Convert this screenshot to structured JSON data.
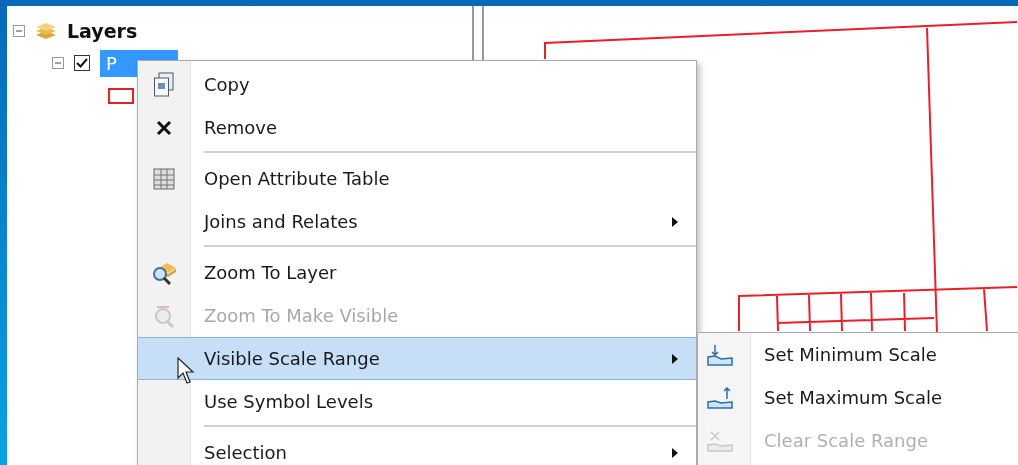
{
  "toc": {
    "root": {
      "label": "Layers",
      "expanded": true,
      "children": [
        {
          "label": "P",
          "checked": true,
          "selected": true,
          "expanded": true
        }
      ]
    }
  },
  "context_menu": {
    "items": [
      {
        "kind": "item",
        "label": "Copy",
        "disabled": false,
        "selected": false,
        "has_submenu": false
      },
      {
        "kind": "item",
        "label": "Remove",
        "disabled": false,
        "selected": false,
        "has_submenu": false
      },
      {
        "kind": "separator"
      },
      {
        "kind": "item",
        "label": "Open Attribute Table",
        "disabled": false,
        "selected": false,
        "has_submenu": false
      },
      {
        "kind": "item",
        "label": "Joins and Relates",
        "disabled": false,
        "selected": false,
        "has_submenu": true
      },
      {
        "kind": "separator"
      },
      {
        "kind": "item",
        "label": "Zoom To Layer",
        "disabled": false,
        "selected": false,
        "has_submenu": false
      },
      {
        "kind": "item",
        "label": "Zoom To Make Visible",
        "disabled": true,
        "selected": false,
        "has_submenu": false
      },
      {
        "kind": "item",
        "label": "Visible Scale Range",
        "disabled": false,
        "selected": true,
        "has_submenu": true
      },
      {
        "kind": "item",
        "label": "Use Symbol Levels",
        "disabled": false,
        "selected": false,
        "has_submenu": false
      },
      {
        "kind": "separator"
      },
      {
        "kind": "item",
        "label": "Selection",
        "disabled": false,
        "selected": false,
        "has_submenu": true
      }
    ]
  },
  "submenu": {
    "items": [
      {
        "label": "Set Minimum Scale",
        "disabled": false
      },
      {
        "label": "Set Maximum Scale",
        "disabled": false
      },
      {
        "label": "Clear Scale Range",
        "disabled": true
      }
    ]
  }
}
